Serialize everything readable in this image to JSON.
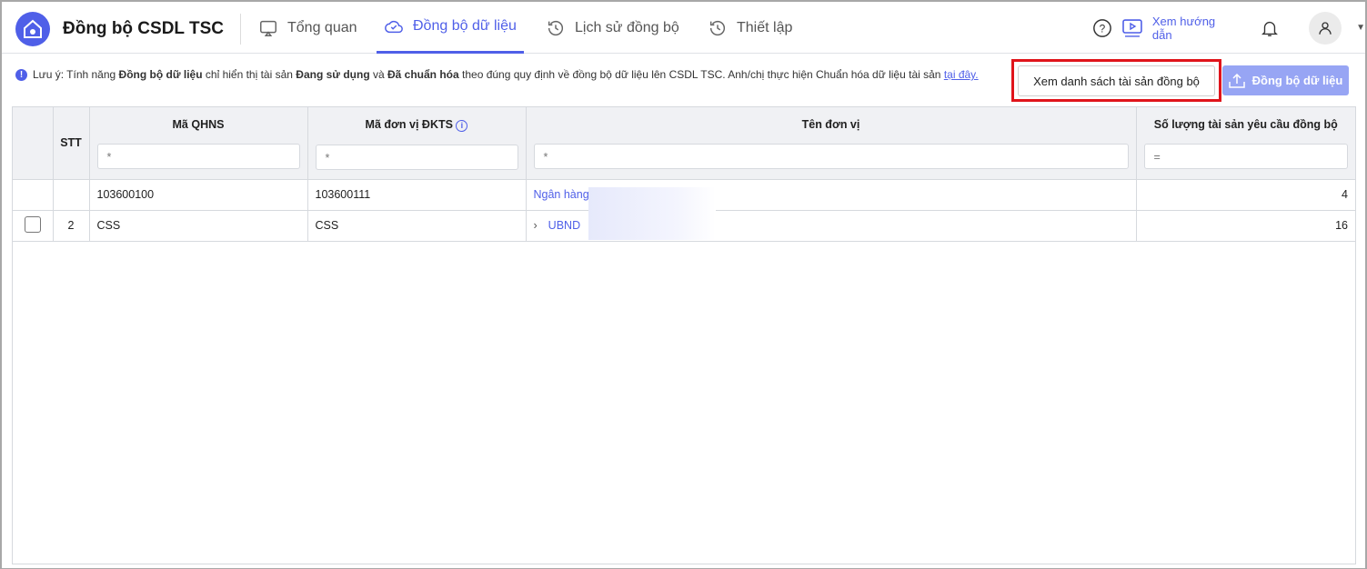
{
  "app": {
    "title": "Đồng bộ CSDL TSC"
  },
  "tabs": [
    {
      "label": "Tổng quan",
      "icon": "monitor-icon"
    },
    {
      "label": "Đồng bộ dữ liệu",
      "icon": "cloud-check-icon",
      "active": true
    },
    {
      "label": "Lịch sử đồng bộ",
      "icon": "history-icon"
    },
    {
      "label": "Thiết lập",
      "icon": "history-icon"
    }
  ],
  "header": {
    "guide": "Xem hướng dẫn"
  },
  "note": {
    "p1": "Lưu ý: Tính năng ",
    "b1": "Đồng bộ dữ liệu",
    "p2": " chỉ hiển thị tài sản ",
    "b2": "Đang sử dụng",
    "p3": " và ",
    "b3": "Đã chuẩn hóa",
    "p4": " theo đúng quy định về đồng bộ dữ liệu lên CSDL TSC. Anh/chị thực hiện Chuẩn hóa dữ liệu tài sản ",
    "link": "tại đây."
  },
  "actions": {
    "view": "Xem danh sách tài sản đồng bộ",
    "sync": "Đồng bộ dữ liệu"
  },
  "table": {
    "columns": [
      "STT",
      "Mã QHNS",
      "Mã đơn vị ĐKTS",
      "Tên đơn vị",
      "Số lượng tài sản yêu cầu đồng bộ"
    ],
    "filters": [
      "*",
      "*",
      "*",
      "="
    ],
    "rows": [
      {
        "stt": "",
        "qhns": "103600100",
        "dkts": "103600111",
        "name": "Ngân hàng",
        "count": "4"
      },
      {
        "stt": "2",
        "qhns": "CSS",
        "dkts": "CSS",
        "name": "UBND",
        "count": "16"
      }
    ]
  },
  "colors": {
    "accent": "#4f5fe8",
    "highlight": "#e0141b"
  }
}
